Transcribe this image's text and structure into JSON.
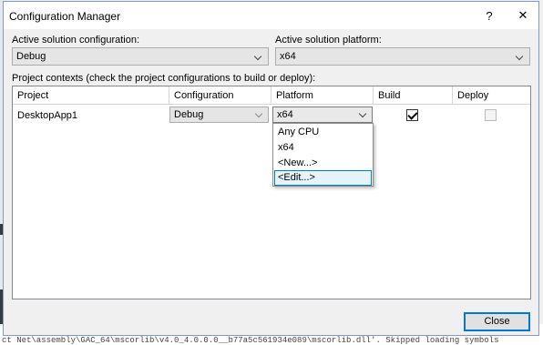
{
  "window": {
    "title": "Configuration Manager",
    "help_glyph": "?",
    "close_glyph": "✕"
  },
  "active_config": {
    "label": "Active solution configuration:",
    "value": "Debug"
  },
  "active_platform": {
    "label": "Active solution platform:",
    "value": "x64"
  },
  "contexts": {
    "label": "Project contexts (check the project configurations to build or deploy):",
    "columns": [
      "Project",
      "Configuration",
      "Platform",
      "Build",
      "Deploy"
    ],
    "rows": [
      {
        "project": "DesktopApp1",
        "configuration": "Debug",
        "platform": "x64",
        "build": true,
        "deploy": false
      }
    ]
  },
  "platform_dropdown": {
    "options": [
      "Any CPU",
      "x64",
      "<New...>",
      "<Edit...>"
    ],
    "highlighted": "<Edit...>"
  },
  "buttons": {
    "close": "Close"
  },
  "background": {
    "output_text": "ct Net\\assembly\\GAC_64\\mscorlib\\v4.0_4.0.0.0__b77a5c561934e089\\mscorlib.dll'. Skipped loading symbols"
  },
  "colors": {
    "accent": "#0078d7",
    "dialog_bg": "#f0f0f0",
    "dropdown_hover": "#e5f3fb"
  }
}
